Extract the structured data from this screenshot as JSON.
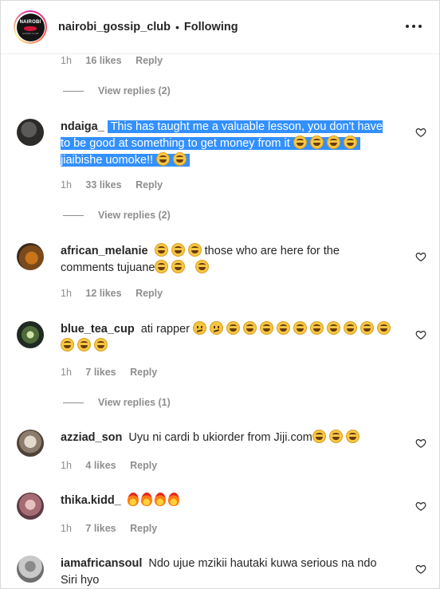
{
  "header": {
    "username": "nairobi_gossip_club",
    "separator": "•",
    "follow_status": "Following",
    "logo_text": "NAIROBI",
    "logo_sub": "GOSSIP CLUB"
  },
  "top_meta": {
    "time": "1h",
    "likes": "16 likes",
    "reply": "Reply"
  },
  "top_view_replies": "View replies (2)",
  "comments": [
    {
      "username": "ndaiga_",
      "text": "This has taught me a valuable lesson, you don't have to be good at something to get money from it",
      "text2": "jiaibishe uomoke!!",
      "time": "1h",
      "likes": "33 likes",
      "reply": "Reply",
      "view_replies": "View replies (2)"
    },
    {
      "username": "african_melanie",
      "text": "those who are here for the comments tujuane",
      "time": "1h",
      "likes": "12 likes",
      "reply": "Reply"
    },
    {
      "username": "blue_tea_cup",
      "text": "ati rapper",
      "time": "1h",
      "likes": "7 likes",
      "reply": "Reply",
      "view_replies": "View replies (1)"
    },
    {
      "username": "azziad_son",
      "text": "Uyu ni cardi b ukiorder from Jiji.com",
      "time": "1h",
      "likes": "4 likes",
      "reply": "Reply"
    },
    {
      "username": "thika.kidd_",
      "text": "",
      "time": "1h",
      "likes": "7 likes",
      "reply": "Reply"
    },
    {
      "username": "iamafricansoul",
      "text": "Ndo ujue mzikii hautaki kuwa serious na ndo Siri hyo",
      "time": "",
      "likes": "",
      "reply": ""
    }
  ],
  "icons": {
    "heart": "heart-icon",
    "more": "more-options-icon",
    "laugh": "face-with-tears-of-joy-emoji",
    "think": "thinking-face-emoji",
    "fire": "fire-emoji"
  }
}
